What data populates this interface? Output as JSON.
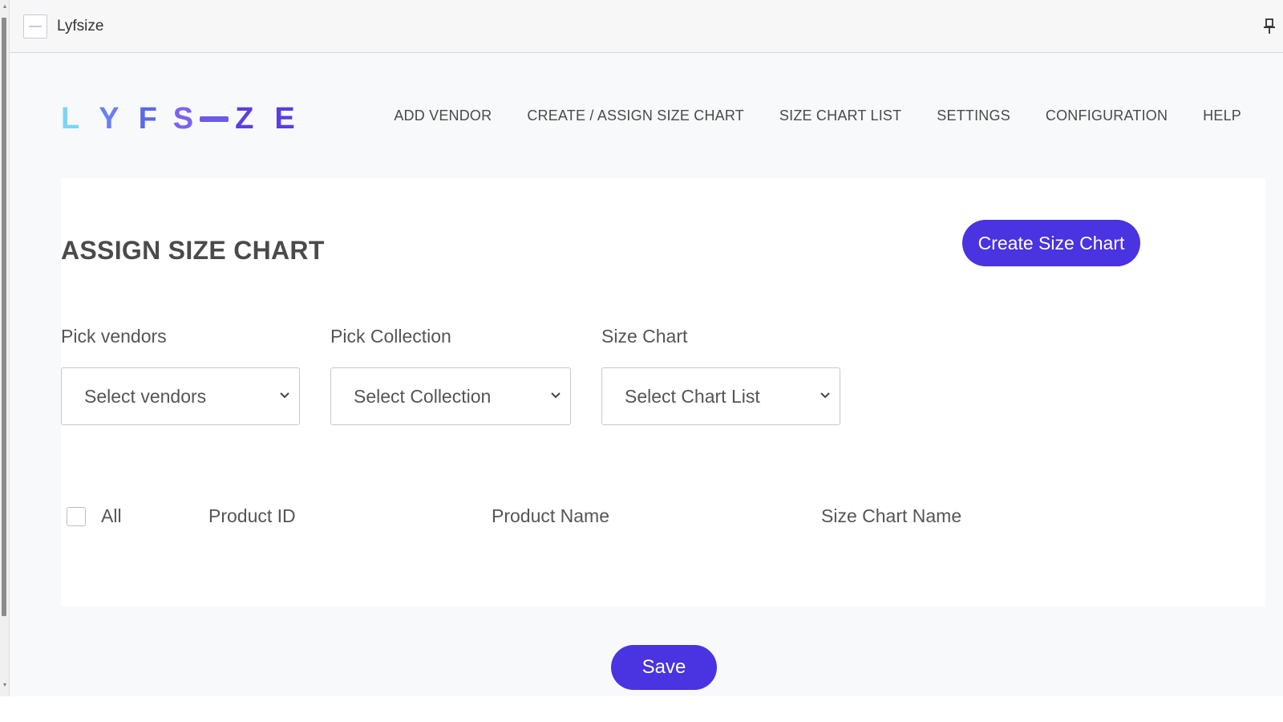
{
  "window": {
    "title": "Lyfsize",
    "app_icon": "app-icon",
    "pin_icon": "pin-icon"
  },
  "logo": {
    "letters": [
      "L",
      "Y",
      "F",
      "S",
      "Z",
      "E"
    ],
    "colors": [
      "#7dd3f5",
      "#6a7ff0",
      "#5a6ae6",
      "#7a63f0",
      "#5b3fe0",
      "#5a3ee0"
    ]
  },
  "nav": {
    "items": [
      "ADD VENDOR",
      "CREATE / ASSIGN SIZE CHART",
      "SIZE CHART LIST",
      "SETTINGS",
      "CONFIGURATION",
      "HELP"
    ]
  },
  "page": {
    "title": "ASSIGN SIZE CHART",
    "create_button": "Create Size Chart"
  },
  "filters": {
    "vendors_label": "Pick vendors",
    "vendors_value": "Select vendors",
    "collection_label": "Pick Collection",
    "collection_value": "Select Collection",
    "chart_label": "Size Chart",
    "chart_value": "Select Chart List"
  },
  "table": {
    "all_label": "All",
    "columns": [
      "Product ID",
      "Product Name",
      "Size Chart Name"
    ]
  },
  "save_label": "Save",
  "colors": {
    "accent": "#4a33e0",
    "background": "#f8f9fb"
  }
}
